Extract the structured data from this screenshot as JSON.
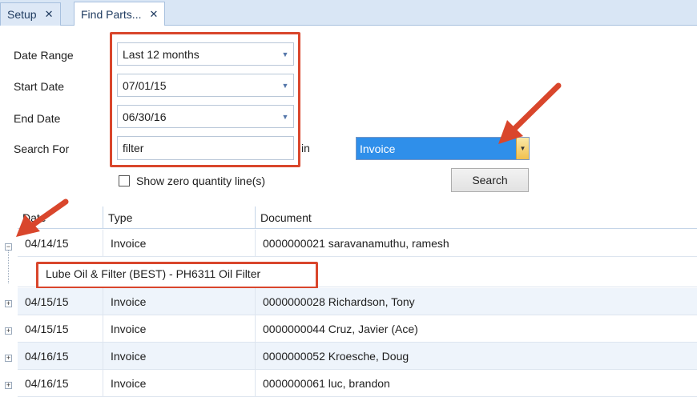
{
  "tabs": [
    {
      "label": "Setup",
      "active": false
    },
    {
      "label": "Find Parts...",
      "active": true
    }
  ],
  "form": {
    "date_range_label": "Date Range",
    "date_range_value": "Last 12 months",
    "start_date_label": "Start Date",
    "start_date_value": "07/01/15",
    "end_date_label": "End Date",
    "end_date_value": "06/30/16",
    "search_for_label": "Search For",
    "search_for_value": "filter",
    "in_label": "in",
    "in_value": "Invoice",
    "show_zero_label": "Show zero quantity line(s)",
    "search_button": "Search"
  },
  "grid": {
    "columns": [
      "Date",
      "Type",
      "Document"
    ],
    "rows": [
      {
        "date": "04/14/15",
        "type": "Invoice",
        "document": "0000000021 saravanamuthu, ramesh",
        "expanded": true
      },
      {
        "date": "04/15/15",
        "type": "Invoice",
        "document": "0000000028 Richardson, Tony",
        "expanded": false
      },
      {
        "date": "04/15/15",
        "type": "Invoice",
        "document": "0000000044 Cruz, Javier (Ace)",
        "expanded": false
      },
      {
        "date": "04/16/15",
        "type": "Invoice",
        "document": "0000000052 Kroesche, Doug",
        "expanded": false
      },
      {
        "date": "04/16/15",
        "type": "Invoice",
        "document": "0000000061 luc, brandon",
        "expanded": false
      }
    ],
    "detail_line": "Lube Oil & Filter (BEST) - PH6311 Oil Filter"
  },
  "colors": {
    "annotation_red": "#d9462c",
    "selected_blue": "#2f8fea",
    "tab_background": "#d9e6f5"
  }
}
